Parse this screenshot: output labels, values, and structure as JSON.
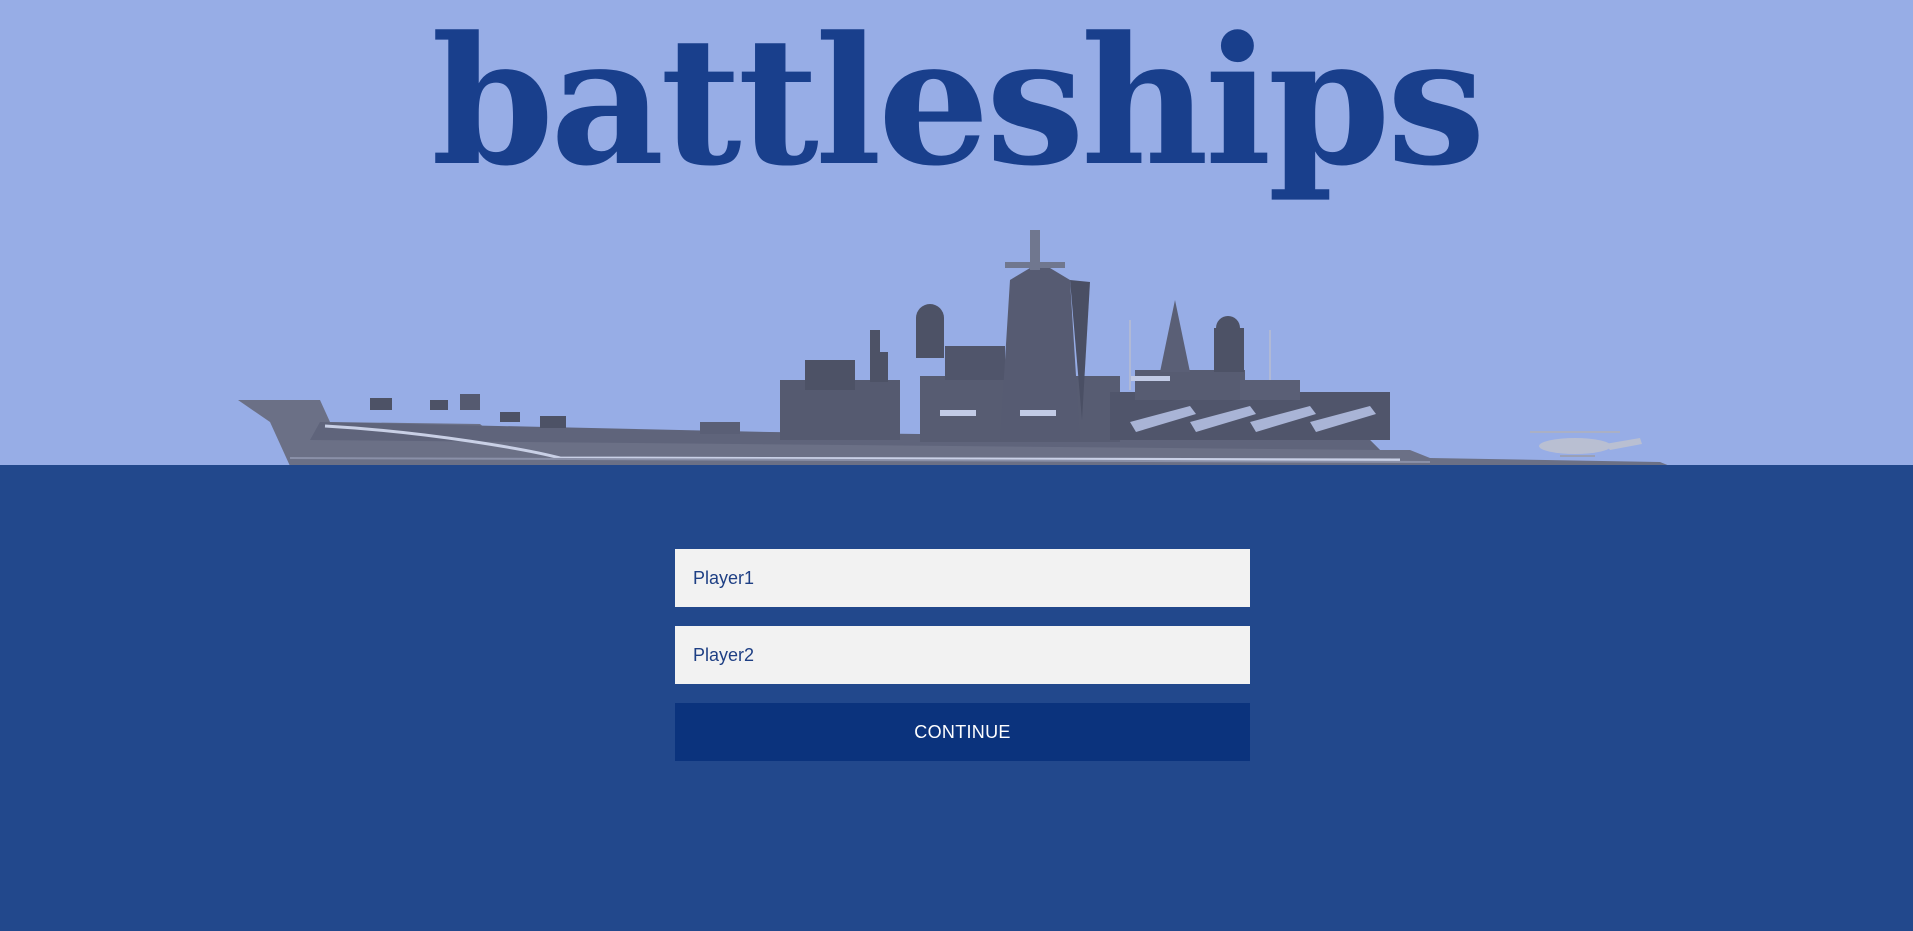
{
  "app": {
    "title": "battleships"
  },
  "hero": {
    "image": "battleship-illustration"
  },
  "form": {
    "player1_placeholder": "Player1",
    "player2_placeholder": "Player2",
    "continue_label": "CONTINUE"
  },
  "colors": {
    "sky": "#97ade6",
    "sea": "#22488c",
    "title": "#193f8c",
    "input_bg": "#f2f2f2",
    "button_bg": "#0b337d",
    "button_text": "#ffffff"
  }
}
